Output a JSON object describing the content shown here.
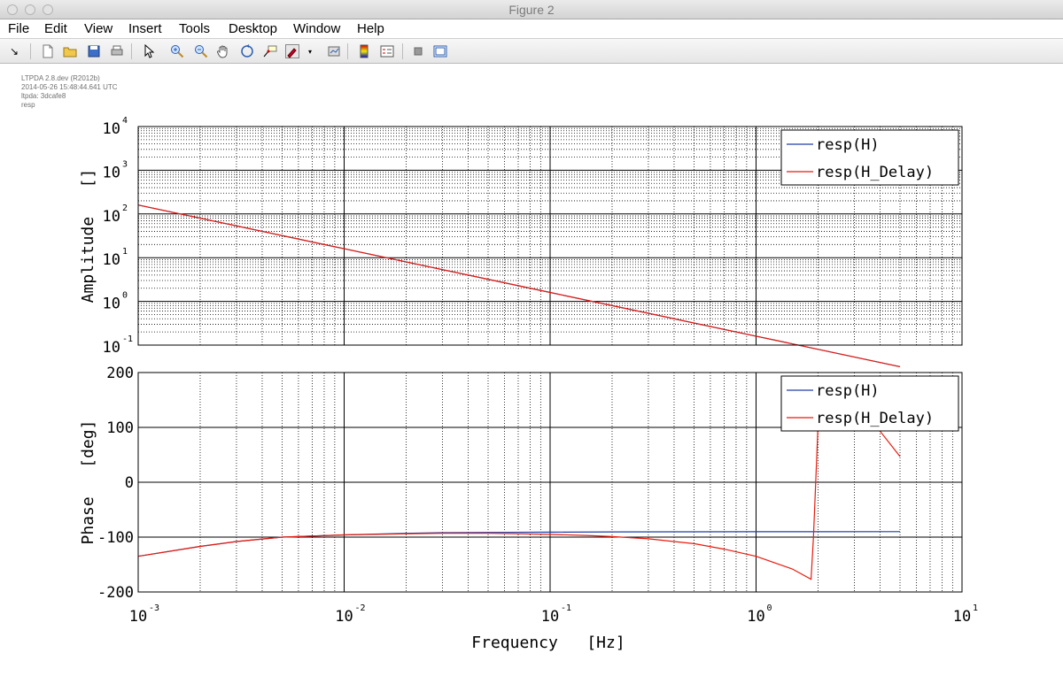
{
  "window": {
    "title": "Figure 2"
  },
  "menu": [
    "File",
    "Edit",
    "View",
    "Insert",
    "Tools",
    "Desktop",
    "Window",
    "Help"
  ],
  "toolbar": [
    {
      "name": "dock-arrow-icon",
      "glyph": "↘"
    },
    {
      "name": "new-figure-icon"
    },
    {
      "name": "open-file-icon"
    },
    {
      "name": "save-icon"
    },
    {
      "name": "print-icon"
    },
    {
      "name": "select-pointer-icon"
    },
    {
      "name": "zoom-in-icon"
    },
    {
      "name": "zoom-out-icon"
    },
    {
      "name": "pan-hand-icon"
    },
    {
      "name": "rotate-3d-icon"
    },
    {
      "name": "data-cursor-icon"
    },
    {
      "name": "brush-icon"
    },
    {
      "name": "link-plot-icon"
    },
    {
      "name": "colorbar-icon"
    },
    {
      "name": "legend-icon"
    },
    {
      "name": "hide-plot-tools-icon"
    },
    {
      "name": "show-plot-tools-icon"
    }
  ],
  "info": [
    "LTPDA 2.8.dev (R2012b)",
    "2014-05-26 15:48:44.641 UTC",
    "ltpda: 3dcafe8",
    "resp"
  ],
  "colors": {
    "H": "#1f3fa8",
    "H_Delay": "#e81b0c"
  },
  "chart_data": [
    {
      "type": "line",
      "xscale": "log",
      "yscale": "log",
      "xlim": [
        0.001,
        10
      ],
      "ylim": [
        0.1,
        10000
      ],
      "ylabel": "Amplitude   []",
      "xlabel": "",
      "ytick_exponents": [
        "4",
        "3",
        "2",
        "1",
        "0",
        "-1"
      ],
      "legend_loc": "top-right",
      "grid": true,
      "series": [
        {
          "name": "resp(H)",
          "x": [
            0.001,
            0.01,
            0.1,
            1,
            5
          ],
          "y": [
            160,
            16,
            1.6,
            0.16,
            0.032
          ]
        },
        {
          "name": "resp(H_Delay)",
          "x": [
            0.001,
            0.01,
            0.1,
            1,
            5
          ],
          "y": [
            160,
            16,
            1.6,
            0.16,
            0.032
          ]
        }
      ]
    },
    {
      "type": "line",
      "xscale": "log",
      "yscale": "linear",
      "xlim": [
        0.001,
        10
      ],
      "ylim": [
        -200,
        200
      ],
      "yticks": [
        "200",
        "100",
        "0",
        "-100",
        "-200"
      ],
      "ylabel": "Phase   [deg]",
      "xlabel": "Frequency   [Hz]",
      "xtick_exponents": [
        "-3",
        "-2",
        "-1",
        "0",
        "1"
      ],
      "legend_loc": "top-right",
      "grid": true,
      "series": [
        {
          "name": "resp(H)",
          "x": [
            0.001,
            0.002,
            0.003,
            0.005,
            0.01,
            0.02,
            0.03,
            0.05,
            0.1,
            0.2,
            0.5,
            1,
            2,
            5
          ],
          "y": [
            -135,
            -117,
            -108,
            -100,
            -96,
            -93,
            -92,
            -91.5,
            -91,
            -90.5,
            -90.3,
            -90.2,
            -90.1,
            -90
          ]
        },
        {
          "name": "resp(H_Delay)",
          "x": [
            0.001,
            0.002,
            0.003,
            0.005,
            0.01,
            0.02,
            0.03,
            0.05,
            0.1,
            0.15,
            0.2,
            0.3,
            0.5,
            0.7,
            1,
            1.5,
            1.85,
            1.9,
            2.0,
            2.5,
            3,
            4,
            5
          ],
          "y": [
            -135,
            -117,
            -108,
            -100,
            -96,
            -94,
            -93,
            -93,
            -95,
            -97,
            -99,
            -103,
            -112,
            -122,
            -135,
            -158,
            -177,
            -100,
            105,
            128,
            118,
            93,
            47
          ]
        }
      ]
    }
  ]
}
